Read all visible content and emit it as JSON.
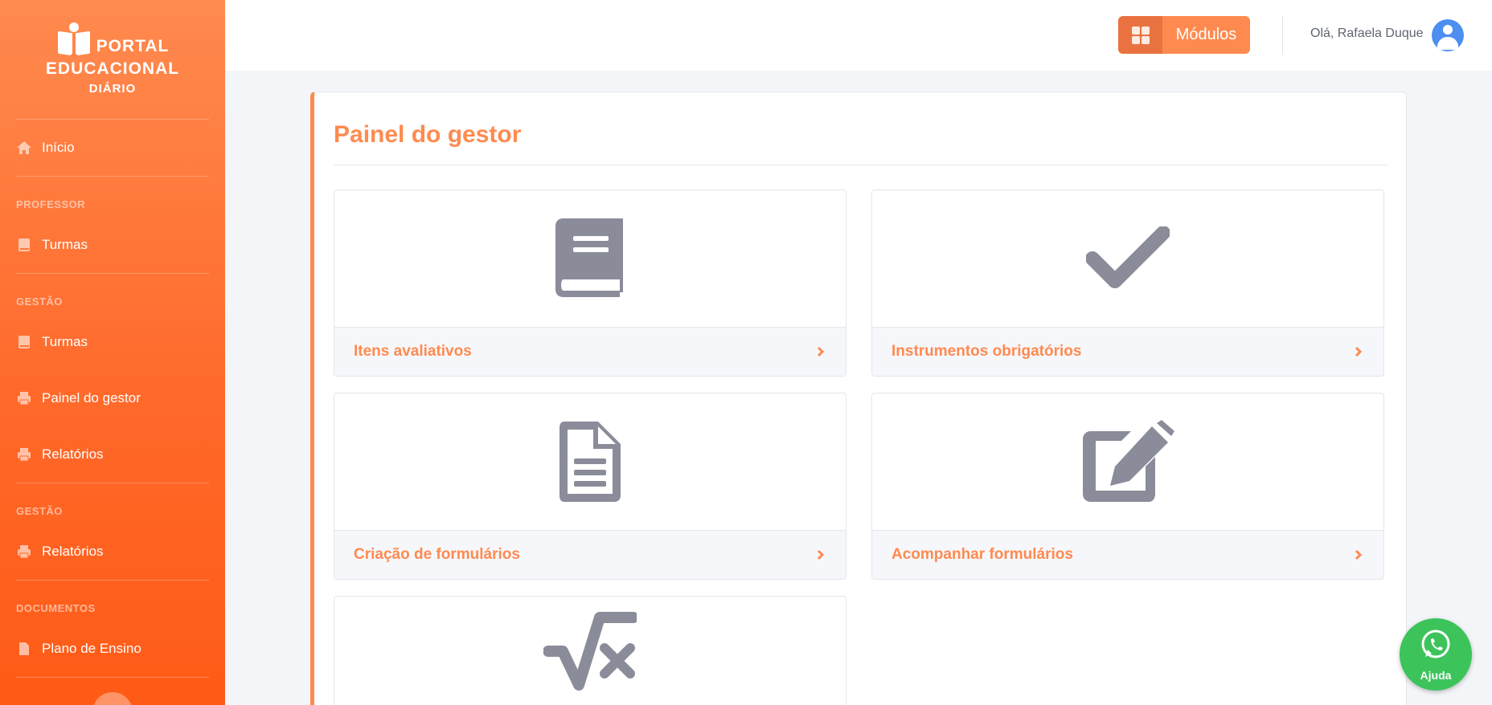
{
  "brand": {
    "line1": "PORTAL",
    "line2": "EDUCACIONAL",
    "line3": "DIÁRIO"
  },
  "sidebar": {
    "items": [
      {
        "type": "item",
        "label": "Início",
        "icon": "home-icon"
      },
      {
        "type": "head",
        "label": "PROFESSOR"
      },
      {
        "type": "item",
        "label": "Turmas",
        "icon": "book-icon"
      },
      {
        "type": "head",
        "label": "GESTÃO"
      },
      {
        "type": "item",
        "label": "Turmas",
        "icon": "book-icon"
      },
      {
        "type": "item",
        "label": "Painel do gestor",
        "icon": "printer-icon"
      },
      {
        "type": "item",
        "label": "Relatórios",
        "icon": "printer-icon"
      },
      {
        "type": "head",
        "label": "GESTÃO"
      },
      {
        "type": "item",
        "label": "Relatórios",
        "icon": "printer-icon"
      },
      {
        "type": "head",
        "label": "DOCUMENTOS"
      },
      {
        "type": "item",
        "label": "Plano de Ensino",
        "icon": "file-icon"
      }
    ]
  },
  "topbar": {
    "modules_label": "Módulos",
    "greeting": "Olá, Rafaela Duque"
  },
  "main": {
    "title": "Painel do gestor",
    "cards": [
      {
        "label": "Itens avaliativos",
        "icon": "book-icon"
      },
      {
        "label": "Instrumentos obrigatórios",
        "icon": "check-icon"
      },
      {
        "label": "Criação de formulários",
        "icon": "file-text-icon"
      },
      {
        "label": "Acompanhar formulários",
        "icon": "edit-icon"
      },
      {
        "label": "",
        "icon": "square-root-icon"
      }
    ]
  },
  "help": {
    "label": "Ajuda"
  },
  "colors": {
    "accent": "#ff8a4f",
    "sidebar_bottom": "#ff5a16",
    "icon_gray": "#8a8c99",
    "whatsapp": "#3cc45b",
    "avatar": "#4d8ff0"
  }
}
